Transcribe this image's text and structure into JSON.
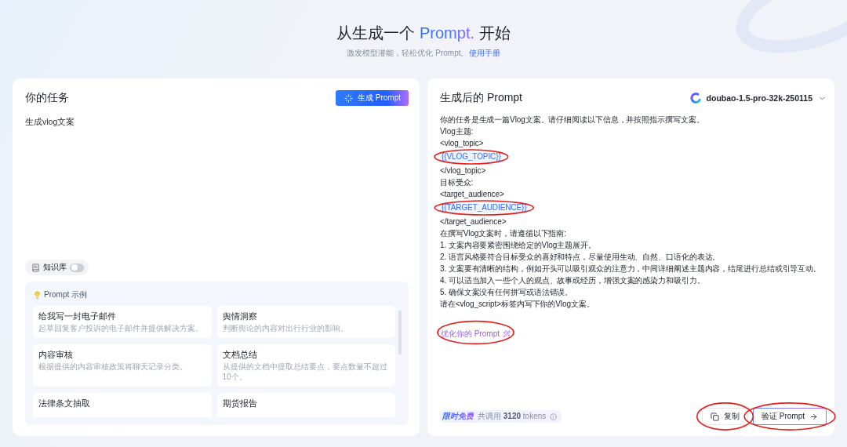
{
  "header": {
    "title": {
      "before": "从生成一个 ",
      "highlight": "Prompt.",
      "after": " 开始"
    },
    "subtitle": "激发模型潜能，轻松优化 Prompt。",
    "manual_link": "使用手册"
  },
  "task_panel": {
    "title": "你的任务",
    "generate_button": "生成 Prompt",
    "task_text": "生成vlog文案",
    "knowledge_base": {
      "label": "知识库",
      "on": false
    },
    "examples": {
      "title": "Prompt 示例",
      "items": [
        {
          "title": "给我写一封电子邮件",
          "description": "起草回复客户投诉的电子邮件并提供解决方案。"
        },
        {
          "title": "舆情洞察",
          "description": "判断舆论的内容对出行行业的影响。"
        },
        {
          "title": "内容审核",
          "description": "根据提供的内容审核政策将聊天记录分类。"
        },
        {
          "title": "文档总结",
          "description": "从提供的文档中提取总结要点，要点数量不超过10个。"
        },
        {
          "title": "法律条文抽取"
        },
        {
          "title": "期货报告"
        }
      ]
    }
  },
  "result_panel": {
    "title": "生成后的 Prompt",
    "model": "doubao-1.5-pro-32k-250115",
    "prompt_lines": [
      {
        "kind": "text",
        "text": "你的任务是生成一篇Vlog文案。请仔细阅读以下信息，并按照指示撰写文案。"
      },
      {
        "kind": "text",
        "text": "Vlog主题:"
      },
      {
        "kind": "text",
        "text": "<vlog_topic>"
      },
      {
        "kind": "variable",
        "text": "{{VLOG_TOPIC}}",
        "circled": true
      },
      {
        "kind": "text",
        "text": "</vlog_topic>"
      },
      {
        "kind": "text",
        "text": "目标受众:"
      },
      {
        "kind": "text",
        "text": "<target_audience>"
      },
      {
        "kind": "variable",
        "text": "{{TARGET_AUDIENCE}}",
        "circled": true
      },
      {
        "kind": "text",
        "text": "</target_audience>"
      },
      {
        "kind": "text",
        "text": "在撰写Vlog文案时，请遵循以下指南:"
      },
      {
        "kind": "text",
        "text": "1. 文案内容要紧密围绕给定的Vlog主题展开。"
      },
      {
        "kind": "text",
        "text": "2. 语言风格要符合目标受众的喜好和特点，尽量使用生动、自然、口语化的表达。"
      },
      {
        "kind": "text",
        "text": "3. 文案要有清晰的结构，例如开头可以吸引观众的注意力，中间详细阐述主题内容，结尾进行总结或引导互动。"
      },
      {
        "kind": "text",
        "text": "4. 可以适当加入一些个人的观点、故事或经历，增强文案的感染力和吸引力。"
      },
      {
        "kind": "text",
        "text": "5. 确保文案没有任何拼写或语法错误。"
      },
      {
        "kind": "text",
        "text": "请在<vlog_script>标签内写下你的Vlog文案。"
      }
    ],
    "optimize_link": {
      "label": "优化你的 Prompt",
      "circled": true
    },
    "usage": {
      "badge": "限时免费",
      "text": "共调用 **3120** tokens"
    },
    "buttons": [
      {
        "kind": "copy",
        "label": "复制",
        "circled": true
      },
      {
        "kind": "verify",
        "label": "验证 Prompt",
        "circled": true
      }
    ]
  }
}
